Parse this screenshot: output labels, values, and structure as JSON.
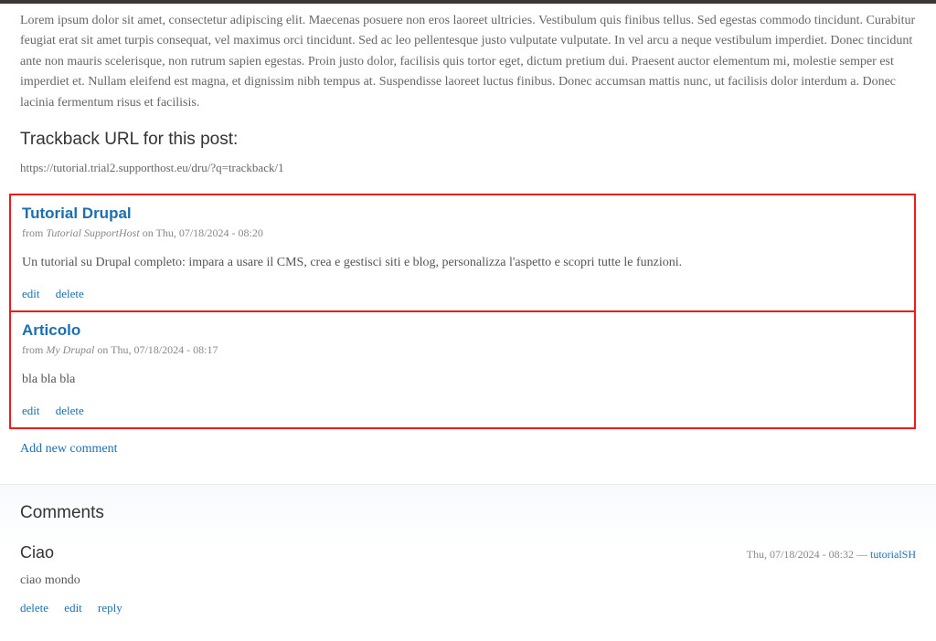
{
  "post": {
    "body": "Lorem ipsum dolor sit amet, consectetur adipiscing elit. Maecenas posuere non eros laoreet ultricies. Vestibulum quis finibus tellus. Sed egestas commodo tincidunt. Curabitur feugiat erat sit amet turpis consequat, vel maximus orci tincidunt. Sed ac leo pellentesque justo vulputate vulputate. In vel arcu a neque vestibulum imperdiet. Donec tincidunt ante non mauris scelerisque, non rutrum sapien egestas. Proin justo dolor, facilisis quis tortor eget, dictum pretium dui. Praesent auctor elementum mi, molestie semper est imperdiet et. Nullam eleifend est magna, et dignissim nibh tempus at. Suspendisse laoreet luctus finibus. Donec accumsan mattis nunc, ut facilisis dolor interdum a. Donec lacinia fermentum risus et facilisis."
  },
  "trackback": {
    "heading": "Trackback URL for this post:",
    "url": "https://tutorial.trial2.supporthost.eu/dru/?q=trackback/1",
    "items": [
      {
        "title": "Tutorial Drupal",
        "from_label": "from",
        "source": "Tutorial SupportHost",
        "on_label": "on",
        "date": "Thu, 07/18/2024 - 08:20",
        "body": "Un tutorial su Drupal completo: impara a usare il CMS, crea e gestisci siti e blog, personalizza l'aspetto e scopri tutte le funzioni.",
        "edit": "edit",
        "delete": "delete"
      },
      {
        "title": "Articolo",
        "from_label": "from",
        "source": "My Drupal",
        "on_label": "on",
        "date": "Thu, 07/18/2024 - 08:17",
        "body": "bla bla bla",
        "edit": "edit",
        "delete": "delete"
      }
    ]
  },
  "add_comment": "Add new comment",
  "comments": {
    "heading": "Comments",
    "items": [
      {
        "title": "Ciao",
        "date": "Thu, 07/18/2024 - 08:32",
        "separator": " — ",
        "author": "tutorialSH",
        "body": "ciao mondo",
        "delete": "delete",
        "edit": "edit",
        "reply": "reply"
      }
    ]
  }
}
